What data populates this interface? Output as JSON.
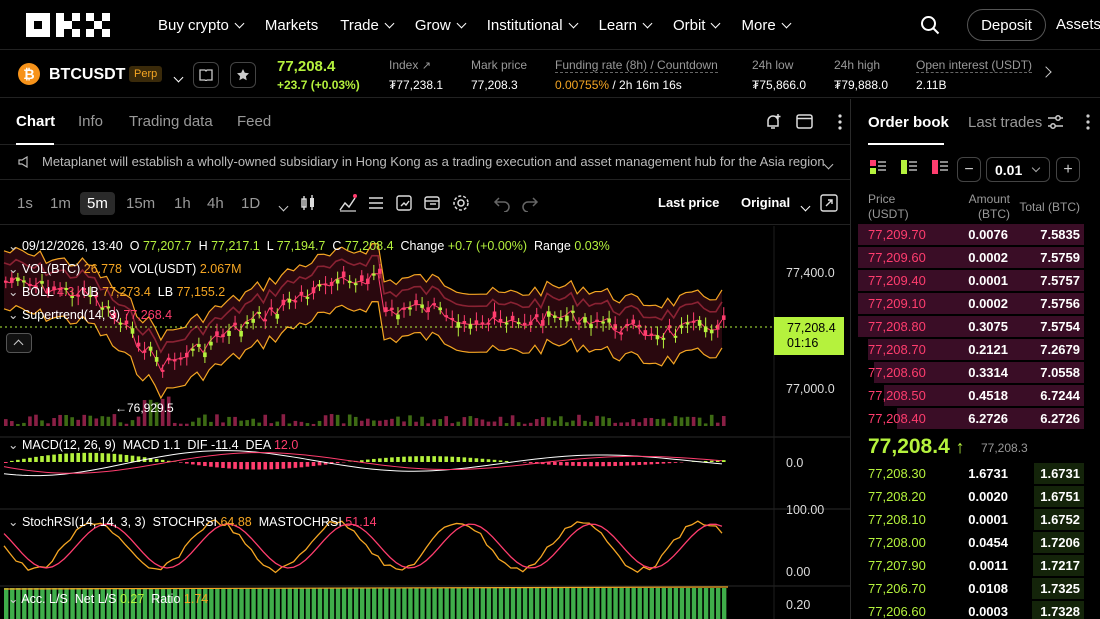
{
  "nav": {
    "items": [
      {
        "label": "Buy crypto",
        "chev": true
      },
      {
        "label": "Markets",
        "chev": false
      },
      {
        "label": "Trade",
        "chev": true
      },
      {
        "label": "Grow",
        "chev": true
      },
      {
        "label": "Institutional",
        "chev": true
      },
      {
        "label": "Learn",
        "chev": true
      },
      {
        "label": "Orbit",
        "chev": true
      },
      {
        "label": "More",
        "chev": true
      }
    ],
    "deposit": "Deposit",
    "assets": "Assets"
  },
  "ticker": {
    "pair": "BTCUSDT",
    "badge": "Perp",
    "last_price": "77,208.4",
    "change": "+23.7 (+0.03%)",
    "index_label": "Index",
    "index_value": "₮77,238.1",
    "mark_label": "Mark price",
    "mark_value": "77,208.3",
    "funding_label": "Funding rate (8h) / Countdown",
    "funding_rate": "0.00755%",
    "funding_countdown": " / 2h 16m 16s",
    "low_label": "24h low",
    "low_value": "₮75,866.0",
    "high_label": "24h high",
    "high_value": "₮79,888.0",
    "oi_label": "Open interest (USDT)",
    "oi_value": "2.11B"
  },
  "chart_tabs": [
    "Chart",
    "Info",
    "Trading data",
    "Feed"
  ],
  "news": "Metaplanet will establish a wholly-owned subsidiary in Hong Kong as a trading execution and asset management hub for the Asia region",
  "timeframes": [
    "1s",
    "1m",
    "5m",
    "15m",
    "1h",
    "4h",
    "1D"
  ],
  "active_timeframe": "5m",
  "price_source": "Last price",
  "price_mode": "Original",
  "indicators": {
    "ohlc_date": "09/12/2026, 13:40",
    "o": "77,207.7",
    "h": "77,217.1",
    "l": "77,194.7",
    "c": "77,208.4",
    "change": "+0.7 (+0.00%)",
    "range": "0.03%",
    "vol_btc": "26.778",
    "vol_usdt": "2.067M",
    "boll_mid": "4.3",
    "ub": "77,273.4",
    "lb": "77,155.2",
    "supertrend_label": "Supertrend(14, 3)",
    "supertrend": "77,268.4",
    "low_marker": "←76,929.5",
    "macd_label": "MACD(12, 26, 9)",
    "macd": "1.1",
    "dif": "-11.4",
    "dea": "12.0",
    "stoch_label": "StochRSI(14, 14, 3, 3)",
    "stochrsi": "64.88",
    "mastochrsi": "51.14",
    "ls_label": "Acc. L/S",
    "net_ls": "0.27",
    "ratio": "1.74"
  },
  "labels": {
    "o": "O",
    "h": "H",
    "l": "L",
    "c": "C",
    "change": "Change",
    "range": "Range",
    "vol_btc": "VOL(BTC)",
    "vol_usdt": "VOL(USDT)",
    "boll": "BOLL",
    "ub": "UB",
    "lb": "LB",
    "macd": "MACD",
    "dif": "DIF",
    "dea": "DEA",
    "stochrsi": "STOCHRSI",
    "mastochrsi": "MASTOCHRSI",
    "net_ls": "Net L/S",
    "ratio": "Ratio"
  },
  "axis": {
    "price_hi": "77,400.0",
    "price_lo": "77,000.0",
    "current": "77,208.4",
    "countdown": "01:16",
    "macd_zero": "0.0",
    "stoch_hi": "100.00",
    "stoch_lo": "0.00",
    "ls": "0.20"
  },
  "orderbook": {
    "tab_book": "Order book",
    "tab_trades": "Last trades",
    "tick": "0.01",
    "hdr_price": "Price (USDT)",
    "hdr_amount": "Amount (BTC)",
    "hdr_total": "Total (BTC)",
    "asks": [
      {
        "price": "77,209.70",
        "amount": "0.0076",
        "total": "7.5835",
        "depth": 1.0
      },
      {
        "price": "77,209.60",
        "amount": "0.0002",
        "total": "7.5759",
        "depth": 0.999
      },
      {
        "price": "77,209.40",
        "amount": "0.0001",
        "total": "7.5757",
        "depth": 0.999
      },
      {
        "price": "77,209.10",
        "amount": "0.0002",
        "total": "7.5756",
        "depth": 0.999
      },
      {
        "price": "77,208.80",
        "amount": "0.3075",
        "total": "7.5754",
        "depth": 0.999
      },
      {
        "price": "77,208.70",
        "amount": "0.2121",
        "total": "7.2679",
        "depth": 0.958
      },
      {
        "price": "77,208.60",
        "amount": "0.3314",
        "total": "7.0558",
        "depth": 0.93
      },
      {
        "price": "77,208.50",
        "amount": "0.4518",
        "total": "6.7244",
        "depth": 0.887
      },
      {
        "price": "77,208.40",
        "amount": "6.2726",
        "total": "6.2726",
        "depth": 0.827
      }
    ],
    "mid_price": "77,208.4",
    "mid_mark": "77,208.3",
    "bids": [
      {
        "price": "77,208.30",
        "amount": "1.6731",
        "total": "1.6731",
        "depth": 0.22
      },
      {
        "price": "77,208.20",
        "amount": "0.0020",
        "total": "1.6751",
        "depth": 0.22
      },
      {
        "price": "77,208.10",
        "amount": "0.0001",
        "total": "1.6752",
        "depth": 0.22
      },
      {
        "price": "77,208.00",
        "amount": "0.0454",
        "total": "1.7206",
        "depth": 0.227
      },
      {
        "price": "77,207.90",
        "amount": "0.0011",
        "total": "1.7217",
        "depth": 0.227
      },
      {
        "price": "77,206.70",
        "amount": "0.0108",
        "total": "1.7325",
        "depth": 0.228
      },
      {
        "price": "77,206.60",
        "amount": "0.0003",
        "total": "1.7328",
        "depth": 0.228
      }
    ]
  },
  "colors": {
    "up": "#b5f23d",
    "down": "#ff3d6e",
    "accent": "#f5a623"
  }
}
